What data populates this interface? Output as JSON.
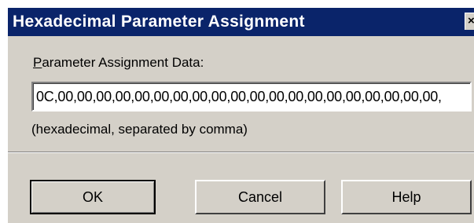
{
  "window": {
    "title": "Hexadecimal Parameter Assignment",
    "close_symbol": "×"
  },
  "form": {
    "label_accel": "P",
    "label_rest": "arameter Assignment Data:",
    "value": "0C,00,00,00,00,00,00,00,00,00,00,00,00,00,00,00,00,00,00,00,00,",
    "hint": "(hexadecimal, separated by comma)"
  },
  "buttons": {
    "ok": "OK",
    "cancel": "Cancel",
    "help": "Help"
  },
  "colors": {
    "titlebar": "#0a246a",
    "dialog_face": "#d4d0c8"
  }
}
